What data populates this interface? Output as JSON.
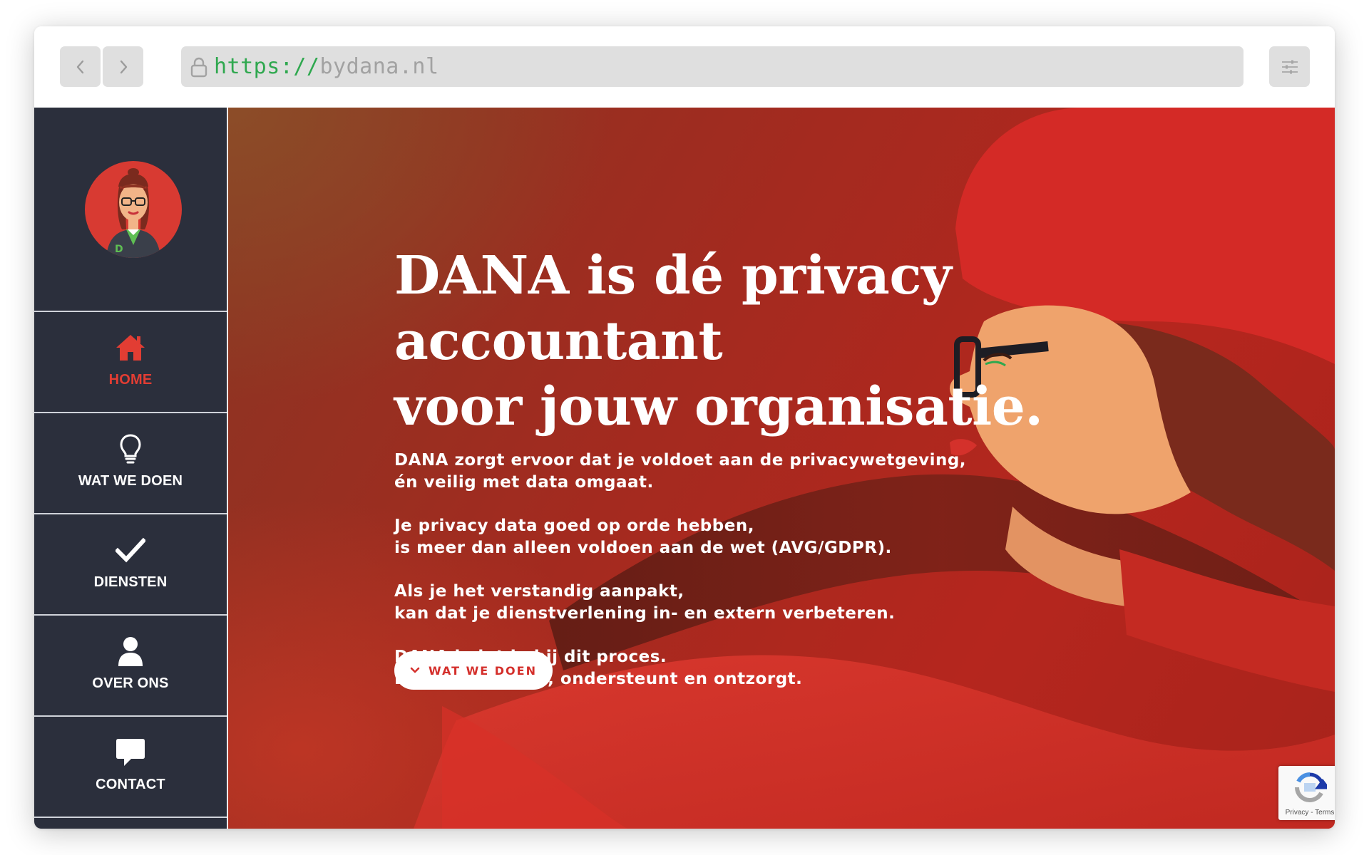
{
  "browser": {
    "url_protocol": "https://",
    "url_domain": "bydana.nl",
    "icons": {
      "back": "chevron-left-icon",
      "forward": "chevron-right-icon",
      "lock": "lock-icon",
      "menu": "sliders-icon"
    }
  },
  "sidebar": {
    "logo_letter": "D",
    "items": [
      {
        "label": "HOME",
        "icon": "home-icon",
        "active": true
      },
      {
        "label": "WAT WE DOEN",
        "icon": "lightbulb-icon",
        "active": false
      },
      {
        "label": "DIENSTEN",
        "icon": "checkmark-icon",
        "active": false
      },
      {
        "label": "OVER ONS",
        "icon": "user-icon",
        "active": false
      },
      {
        "label": "CONTACT",
        "icon": "chat-bubble-icon",
        "active": false
      }
    ]
  },
  "hero": {
    "headline_line1": "DANA is dé privacy accountant",
    "headline_line2": "voor jouw organisatie.",
    "paragraphs": [
      [
        "DANA zorgt ervoor dat je voldoet aan de privacywetgeving,",
        "én veilig met data omgaat."
      ],
      [
        "Je privacy data goed op orde hebben,",
        "is meer dan alleen voldoen aan de wet (AVG/GDPR)."
      ],
      [
        "Als je het verstandig aanpakt,",
        "kan dat je dienstverlening in- en extern verbeteren."
      ],
      [
        "DANA helpt je bij dit proces.",
        "DANA geeft tips, ondersteunt en ontzorgt."
      ]
    ],
    "cta_label": "WAT WE DOEN"
  },
  "recaptcha": {
    "links": "Privacy - Terms"
  },
  "colors": {
    "accent_red": "#e23d33",
    "sidebar_bg": "#2b2f3c",
    "url_protocol_green": "#2fa84f"
  }
}
